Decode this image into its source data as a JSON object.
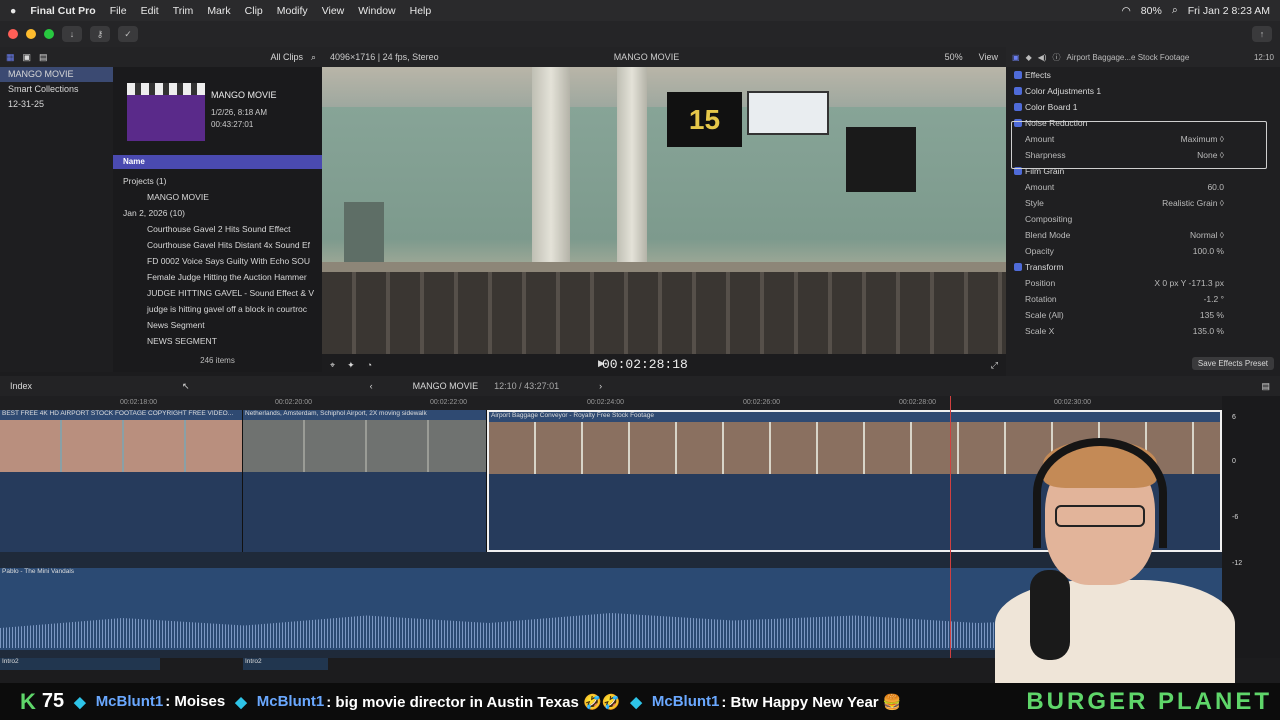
{
  "menubar": {
    "apple": "",
    "app": "Final Cut Pro",
    "items": [
      "File",
      "Edit",
      "Trim",
      "Mark",
      "Clip",
      "Modify",
      "View",
      "Window",
      "Help"
    ],
    "battery": "80%",
    "datetime": "Fri Jan 2  8:23 AM"
  },
  "library": {
    "filter": "All Clips",
    "sidebar": [
      "MANGO MOVIE",
      "Smart Collections",
      "12-31-25"
    ],
    "project": {
      "title": "MANGO MOVIE",
      "date": "1/2/26, 8:18 AM",
      "duration": "00:43:27:01"
    },
    "column_name": "Name",
    "rows": [
      "Projects  (1)",
      "MANGO MOVIE",
      "Jan 2, 2026  (10)",
      "Courthouse Gavel 2 Hits Sound Effect",
      "Courthouse Gavel Hits Distant 4x Sound Ef",
      "FD 0002  Voice Says Guilty With Echo SOU",
      "Female Judge Hitting the Auction Hammer",
      "JUDGE HITTING GAVEL - Sound Effect & V",
      "judge is hitting gavel off a block in courtroc",
      "News Segment",
      "NEWS SEGMENT"
    ],
    "item_count": "246 items"
  },
  "viewer": {
    "format": "4096×1716 | 24 fps, Stereo",
    "title": "MANGO MOVIE",
    "zoom": "50%",
    "view": "View",
    "sign_number": "15",
    "timecode": "00:02:28:18"
  },
  "inspector": {
    "clip_name": "Airport Baggage...e Stock Footage",
    "clip_time": "12:10",
    "rows": [
      {
        "label": "Effects",
        "value": "",
        "cb": true
      },
      {
        "label": "Color Adjustments 1",
        "value": "",
        "cb": true
      },
      {
        "label": "Color Board 1",
        "value": "",
        "cb": true
      },
      {
        "label": "Noise Reduction",
        "value": "",
        "cb": true
      },
      {
        "label": "Amount",
        "value": "Maximum ◊",
        "cb": false
      },
      {
        "label": "Sharpness",
        "value": "None ◊",
        "cb": false
      },
      {
        "label": "Film Grain",
        "value": "",
        "cb": true
      },
      {
        "label": "Amount",
        "value": "60.0",
        "cb": false
      },
      {
        "label": "Style",
        "value": "Realistic Grain ◊",
        "cb": false
      },
      {
        "label": "Compositing",
        "value": "",
        "cb": false
      },
      {
        "label": "Blend Mode",
        "value": "Normal ◊",
        "cb": false
      },
      {
        "label": "Opacity",
        "value": "100.0  %",
        "cb": false
      },
      {
        "label": "Transform",
        "value": "",
        "cb": true
      },
      {
        "label": "Position",
        "value": "X   0 px   Y  -171.3  px",
        "cb": false
      },
      {
        "label": "Rotation",
        "value": "-1.2  °",
        "cb": false
      },
      {
        "label": "Scale (All)",
        "value": "135  %",
        "cb": false
      },
      {
        "label": "Scale X",
        "value": "135.0  %",
        "cb": false
      }
    ],
    "save_preset": "Save Effects Preset"
  },
  "timeline": {
    "index": "Index",
    "project": "MANGO MOVIE",
    "position": "12:10 / 43:27:01",
    "ruler": [
      "00:02:18:00",
      "00:02:20:00",
      "00:02:22:00",
      "00:02:24:00",
      "00:02:26:00",
      "00:02:28:00",
      "00:02:30:00"
    ],
    "clips": [
      "BEST FREE 4K  HD AIRPORT STOCK FOOTAGE  COPYRIGHT FREE VIDEO...",
      "Netherlands, Amsterdam, Schiphol Airport, 2X moving sidewalk",
      "Airport Baggage Conveyor - Royalty Free Stock Footage"
    ],
    "audio": "Pablo - The Mini Vandals",
    "intros": [
      "Intro2",
      "Intro2"
    ],
    "meter": [
      "6",
      "0",
      "-6",
      "-12"
    ]
  },
  "chat": {
    "k": "K",
    "count": "75",
    "messages": [
      {
        "user": "McBlunt1",
        "text": ": Moises"
      },
      {
        "user": "McBlunt1",
        "text": ": big movie director in Austin Texas 🤣🤣"
      },
      {
        "user": "McBlunt1",
        "text": ": Btw Happy New Year 🍔"
      }
    ],
    "brand": "BURGER PLANET"
  }
}
